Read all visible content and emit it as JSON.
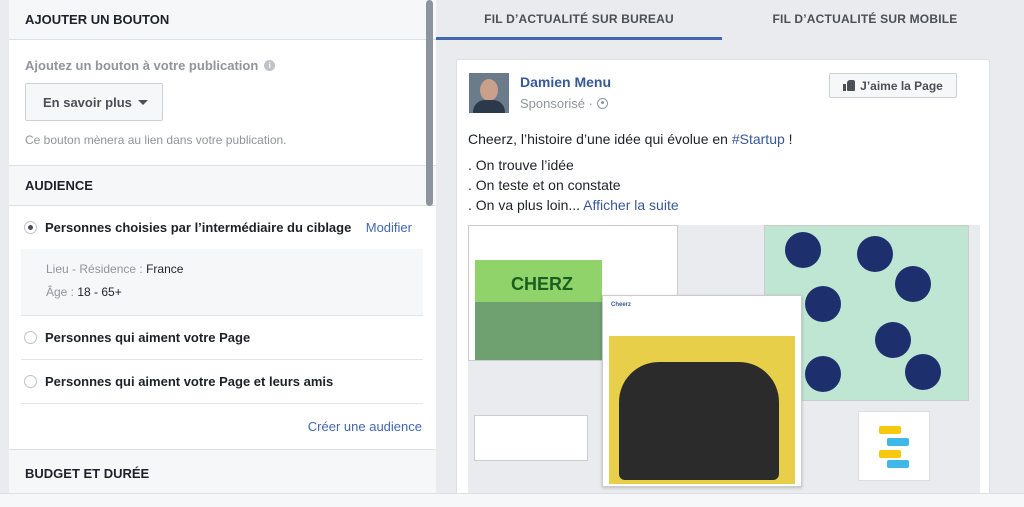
{
  "button_section": {
    "title": "AJOUTER UN BOUTON",
    "question": "Ajoutez un bouton à votre publication",
    "dropdown_value": "En savoir plus",
    "help": "Ce bouton mènera au lien dans votre publication."
  },
  "audience": {
    "title": "AUDIENCE",
    "option1": "Personnes choisies par l’intermédiaire du ciblage",
    "modify": "Modifier",
    "location_label": "Lieu - Résidence : ",
    "location_value": "France",
    "age_label": "Âge : ",
    "age_value": "18 - 65+",
    "option2": "Personnes qui aiment votre Page",
    "option3": "Personnes qui aiment votre Page et leurs amis",
    "create": "Créer une audience"
  },
  "budget": {
    "title": "BUDGET ET DURÉE"
  },
  "tabs": {
    "desktop": "FIL D’ACTUALITÉ SUR BUREAU",
    "mobile": "FIL D’ACTUALITÉ SUR MOBILE"
  },
  "post": {
    "author": "Damien Menu",
    "sponsored": "Sponsorisé ·",
    "like_button": "J’aime la Page",
    "line1_prefix": "Cheerz, l’histoire d’une idée qui évolue en ",
    "hashtag": "#Startup",
    "line1_suffix": " !",
    "line2": ". On trouve l’idée",
    "line3": ". On teste et on constate",
    "line4_prefix": ". On va plus loin... ",
    "see_more": "Afficher la suite"
  },
  "image": {
    "brand": "CHERZ",
    "inner_header": "Cheerz"
  }
}
